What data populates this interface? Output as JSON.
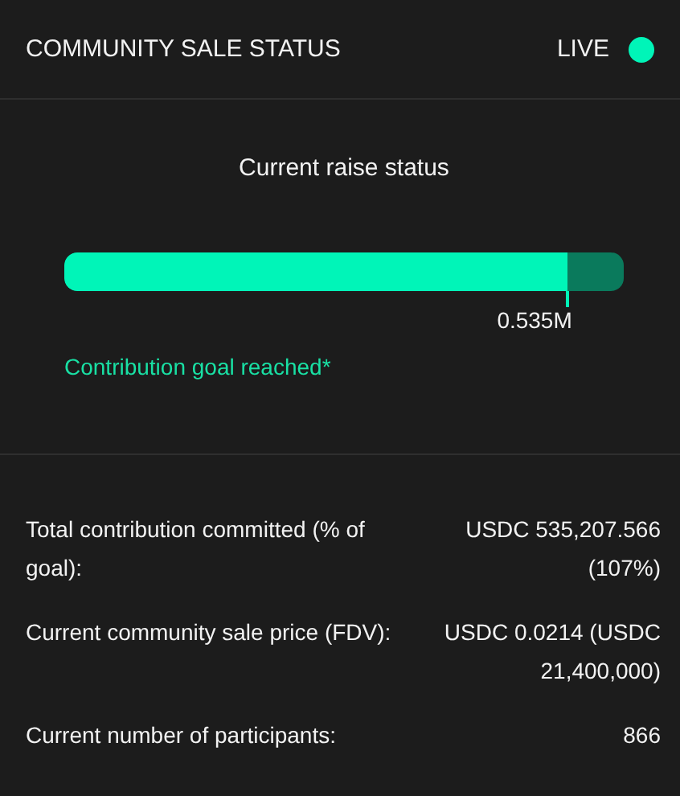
{
  "header": {
    "title": "COMMUNITY SALE STATUS",
    "status": "LIVE",
    "live": true
  },
  "raise": {
    "title": "Current raise status",
    "level": 0.9,
    "marker_label": "0.535M",
    "note": "Contribution goal reached*"
  },
  "stats": [
    {
      "label": "Total contribution committed (% of goal):",
      "value": "USDC 535,207.566 (107%)"
    },
    {
      "label": "Current community sale price (FDV):",
      "value": "USDC 0.0214 (USDC 21,400,000)"
    },
    {
      "label": "Current number of participants:",
      "value": "866"
    }
  ]
}
